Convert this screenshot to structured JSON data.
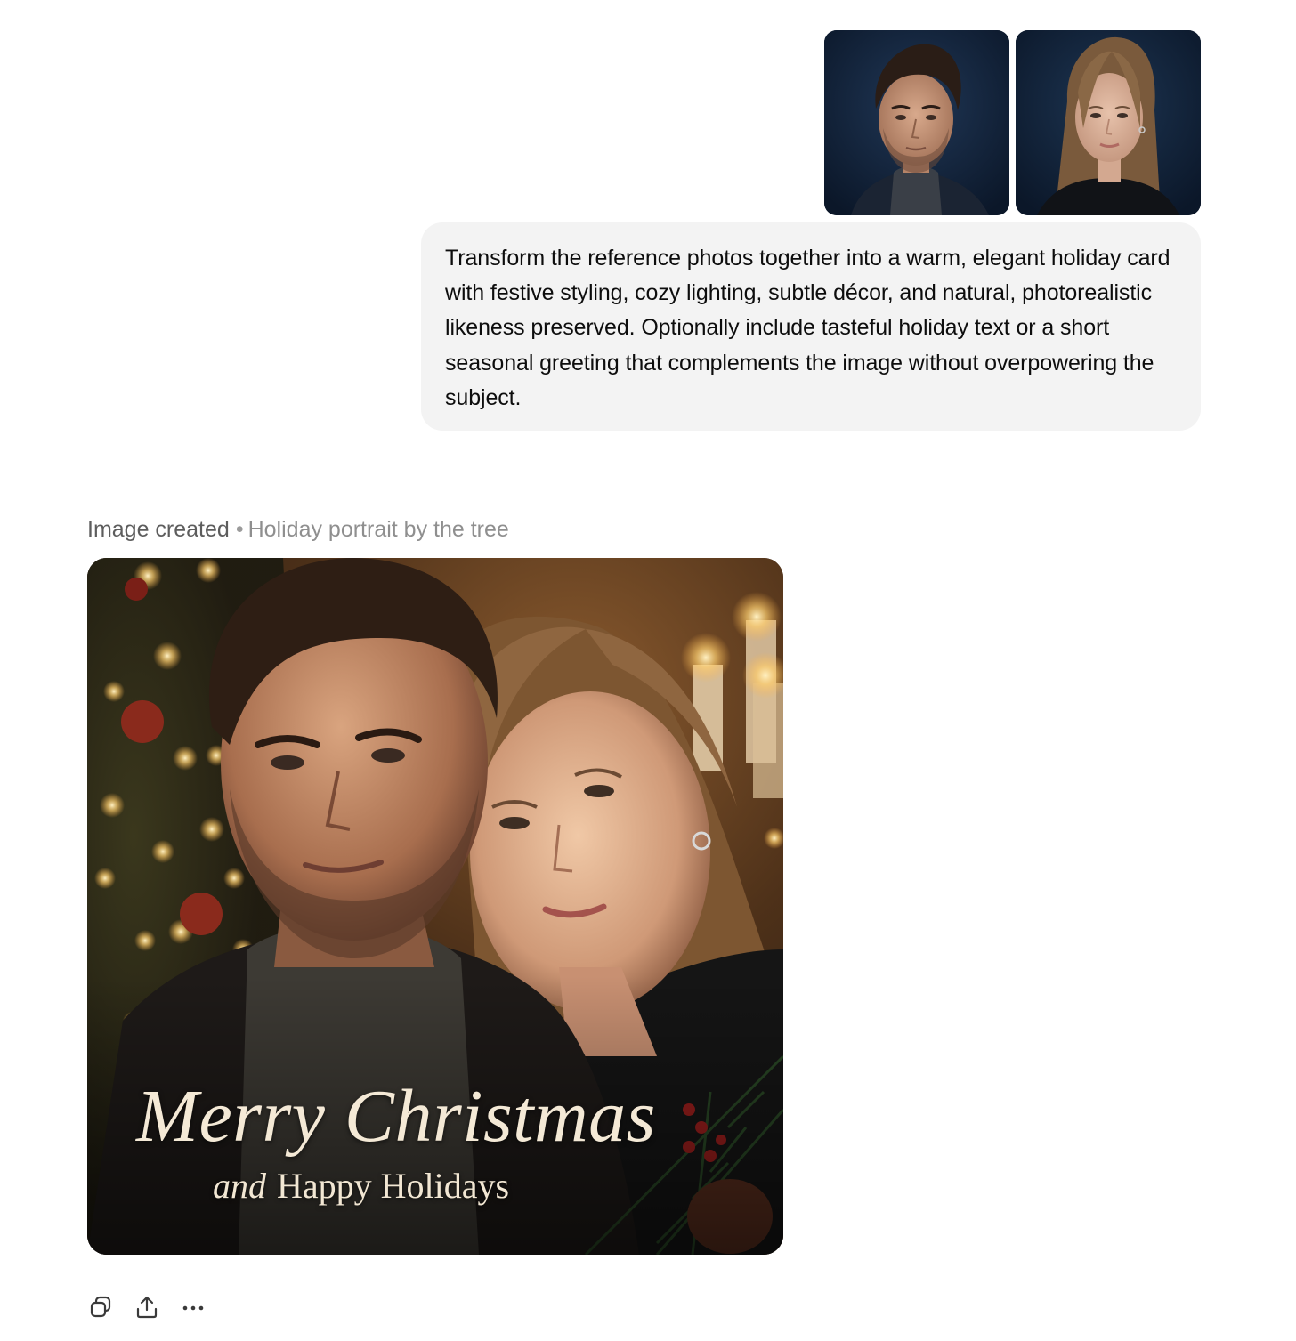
{
  "user_message": {
    "attachments": [
      {
        "icon": "man-portrait-photo",
        "kind": "reference-photo"
      },
      {
        "icon": "woman-portrait-photo",
        "kind": "reference-photo"
      }
    ],
    "text": "Transform the reference photos together into a warm, elegant holiday card with festive styling, cozy lighting, subtle décor, and natural, photorealistic likeness preserved. Optionally include tasteful holiday text or a short seasonal greeting that complements the image without overpowering the subject.",
    "bubble_color": "#f3f3f3"
  },
  "assistant_response": {
    "status": "Image created",
    "separator": "•",
    "caption": "Holiday portrait by the tree",
    "image": {
      "icon": "holiday-card-photo",
      "greeting_main": "Merry Christmas",
      "greeting_and": "and",
      "greeting_rest": "Happy Holidays",
      "text_color": "#f4e9d6"
    },
    "actions": [
      {
        "name": "copy",
        "icon": "copy-icon"
      },
      {
        "name": "share",
        "icon": "share-icon"
      },
      {
        "name": "more",
        "icon": "more-icon"
      }
    ]
  }
}
